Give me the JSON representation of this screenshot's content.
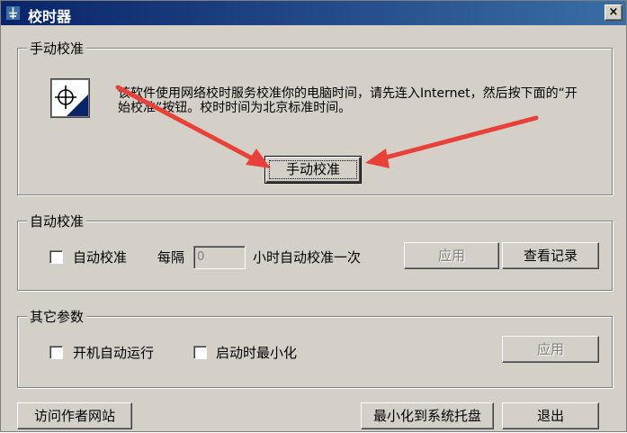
{
  "window": {
    "title": "校时器",
    "close_label": "×"
  },
  "manual_group": {
    "legend": "手动校准",
    "description": "该软件使用网络校时服务校准你的电脑时间，请先连入Internet，然后按下面的“开始校准”按钮。校时时间为北京标准时间。",
    "button_label": "手动校准"
  },
  "auto_group": {
    "legend": "自动校准",
    "checkbox_label": "自动校准",
    "checked": false,
    "interval_label": "每隔",
    "interval_value": "0",
    "interval_suffix": "小时自动校准一次",
    "apply_label": "应用",
    "log_label": "查看记录"
  },
  "other_group": {
    "legend": "其它参数",
    "autorun_label": "开机自动运行",
    "autorun_checked": false,
    "minimize_label": "启动时最小化",
    "minimize_checked": false,
    "apply_label": "应用"
  },
  "footer": {
    "visit_label": "访问作者网站",
    "tray_label": "最小化到系统托盘",
    "exit_label": "退出"
  },
  "colors": {
    "titlebar_start": "#0a246a",
    "titlebar_end": "#3a6ea5",
    "face": "#d4d0c8",
    "annotation_arrow": "#e8413a"
  },
  "icons": {
    "title_icon": "clock-app-icon",
    "app_icon": "time-sync-icon"
  }
}
